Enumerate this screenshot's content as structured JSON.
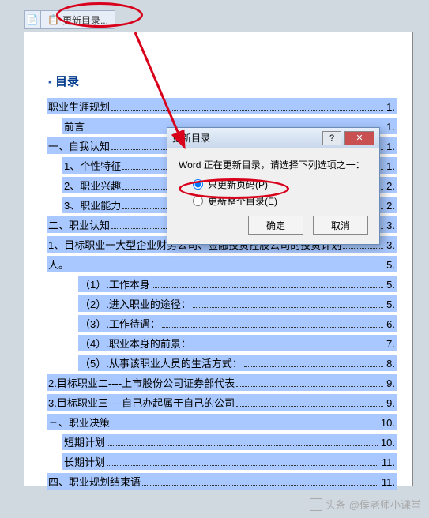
{
  "tab": {
    "update_label": "更新目录..."
  },
  "toc": {
    "title": "目录",
    "items": [
      {
        "text": "职业生涯规划",
        "page": "1",
        "indent": 0
      },
      {
        "text": "前言",
        "page": "1",
        "indent": 1
      },
      {
        "text": "一、自我认知",
        "page": "1",
        "indent": 0
      },
      {
        "text": "1、个性特征",
        "page": "1",
        "indent": 1
      },
      {
        "text": "2、职业兴趣",
        "page": "2",
        "indent": 1
      },
      {
        "text": "3、职业能力",
        "page": "2",
        "indent": 1
      },
      {
        "text": "二、职业认知",
        "page": "3",
        "indent": 0
      },
      {
        "text": "1、目标职业一大型企业财务公司、金融投资控股公司的投资计划",
        "page": "3",
        "indent": 0
      },
      {
        "text": "人。",
        "page": "5",
        "indent": 0
      },
      {
        "text": "（1）.工作本身",
        "page": "5",
        "indent": 2
      },
      {
        "text": "（2）.进入职业的途径：",
        "page": "5",
        "indent": 2
      },
      {
        "text": "（3）.工作待遇：",
        "page": "6",
        "indent": 2
      },
      {
        "text": "（4）.职业本身的前景：",
        "page": "7",
        "indent": 2
      },
      {
        "text": "（5）.从事该职业人员的生活方式：",
        "page": "8",
        "indent": 2
      },
      {
        "text": "2.目标职业二----上市股份公司证券部代表",
        "page": "9",
        "indent": 0
      },
      {
        "text": "3.目标职业三----自己办起属于自己的公司",
        "page": "9",
        "indent": 0
      },
      {
        "text": "三、职业决策",
        "page": "10",
        "indent": 0
      },
      {
        "text": "短期计划",
        "page": "10",
        "indent": 1
      },
      {
        "text": "长期计划",
        "page": "11",
        "indent": 1
      },
      {
        "text": "四、职业规划结束语",
        "page": "11",
        "indent": 0
      }
    ]
  },
  "dialog": {
    "title": "更新目录",
    "message": "Word 正在更新目录，请选择下列选项之一：",
    "opt_pages": "只更新页码(P)",
    "opt_all": "更新整个目录(E)",
    "ok": "确定",
    "cancel": "取消"
  },
  "watermark": {
    "prefix": "头条",
    "text": "@侯老师小课堂"
  }
}
